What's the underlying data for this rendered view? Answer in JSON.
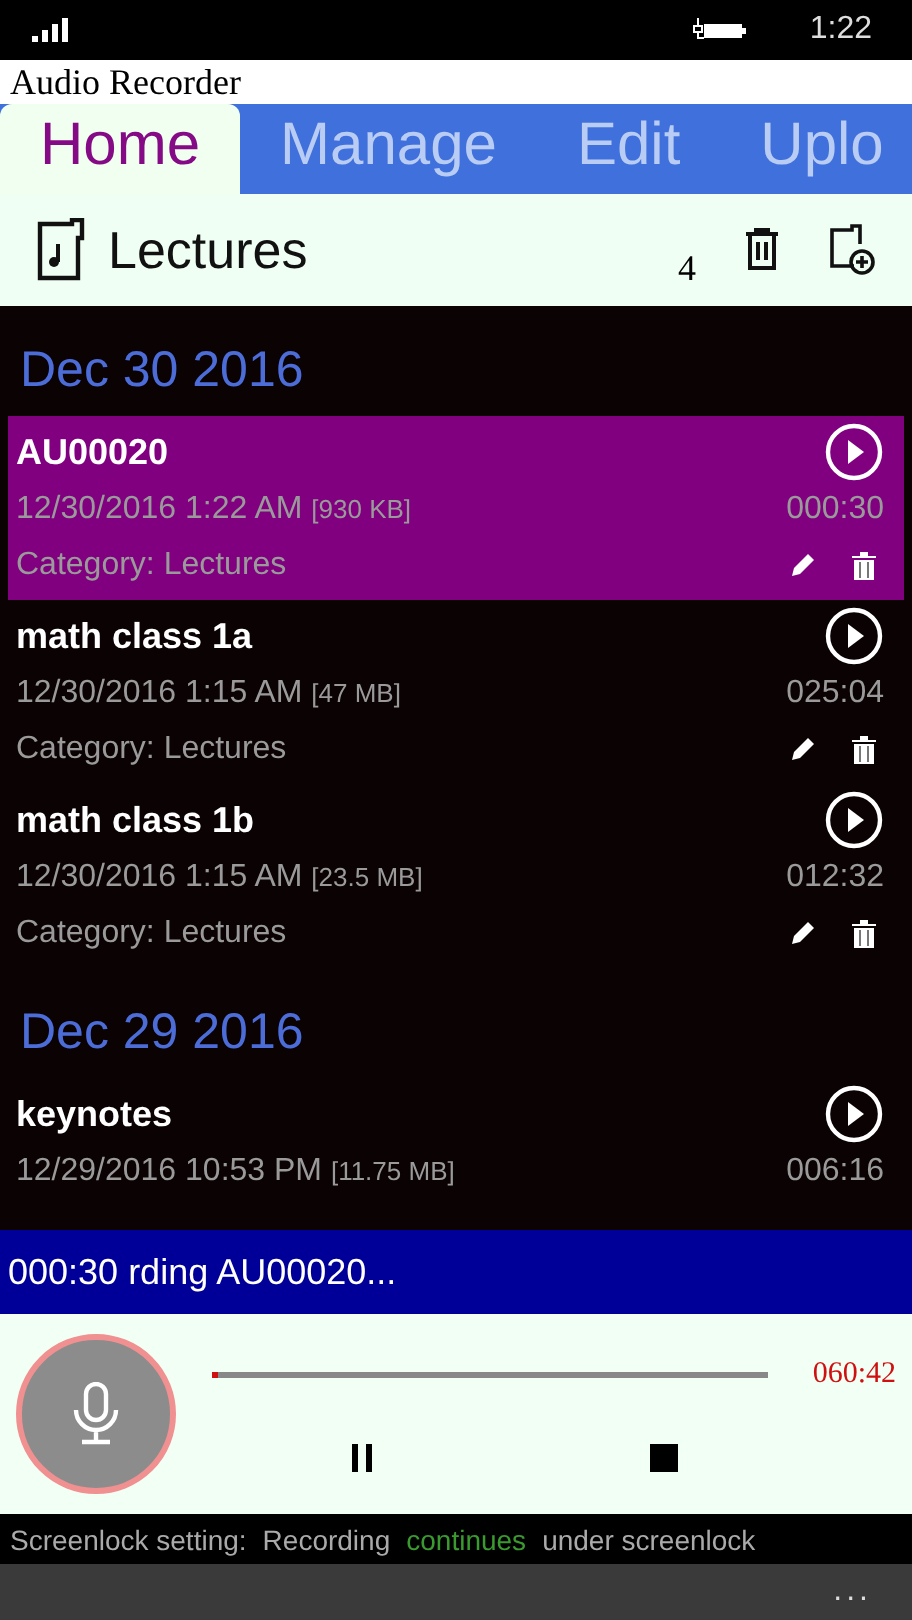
{
  "status_bar": {
    "time": "1:22"
  },
  "window": {
    "title": "Audio Recorder"
  },
  "tabs": [
    {
      "label": "Home",
      "selected": true
    },
    {
      "label": "Manage",
      "selected": false
    },
    {
      "label": "Edit",
      "selected": false
    },
    {
      "label": "Uplo",
      "selected": false
    }
  ],
  "toolbar": {
    "folder": "Lectures",
    "count": "4"
  },
  "groups": [
    {
      "date": "Dec 30 2016",
      "recordings": [
        {
          "title": "AU00020",
          "date": "12/30/2016 1:22 AM",
          "size": "[930 KB]",
          "duration": "000:30",
          "category": "Category: Lectures",
          "selected": true
        },
        {
          "title": "math class 1a",
          "date": "12/30/2016 1:15 AM",
          "size": "[47 MB]",
          "duration": "025:04",
          "category": "Category: Lectures",
          "selected": false
        },
        {
          "title": "math class 1b",
          "date": "12/30/2016 1:15 AM",
          "size": "[23.5 MB]",
          "duration": "012:32",
          "category": "Category: Lectures",
          "selected": false
        }
      ]
    },
    {
      "date": "Dec 29 2016",
      "recordings": [
        {
          "title": "keynotes",
          "date": "12/29/2016 10:53 PM",
          "size": "[11.75 MB]",
          "duration": "006:16",
          "selected": false
        }
      ]
    }
  ],
  "banner": {
    "elapsed": "000:30",
    "message": "rding AU00020..."
  },
  "player": {
    "level": 0.01,
    "remaining": "060:42"
  },
  "footer": {
    "label": "Screenlock setting:",
    "before": "Recording",
    "highlight": "continues",
    "after": "under screenlock"
  },
  "app_bar": {
    "more": "..."
  }
}
